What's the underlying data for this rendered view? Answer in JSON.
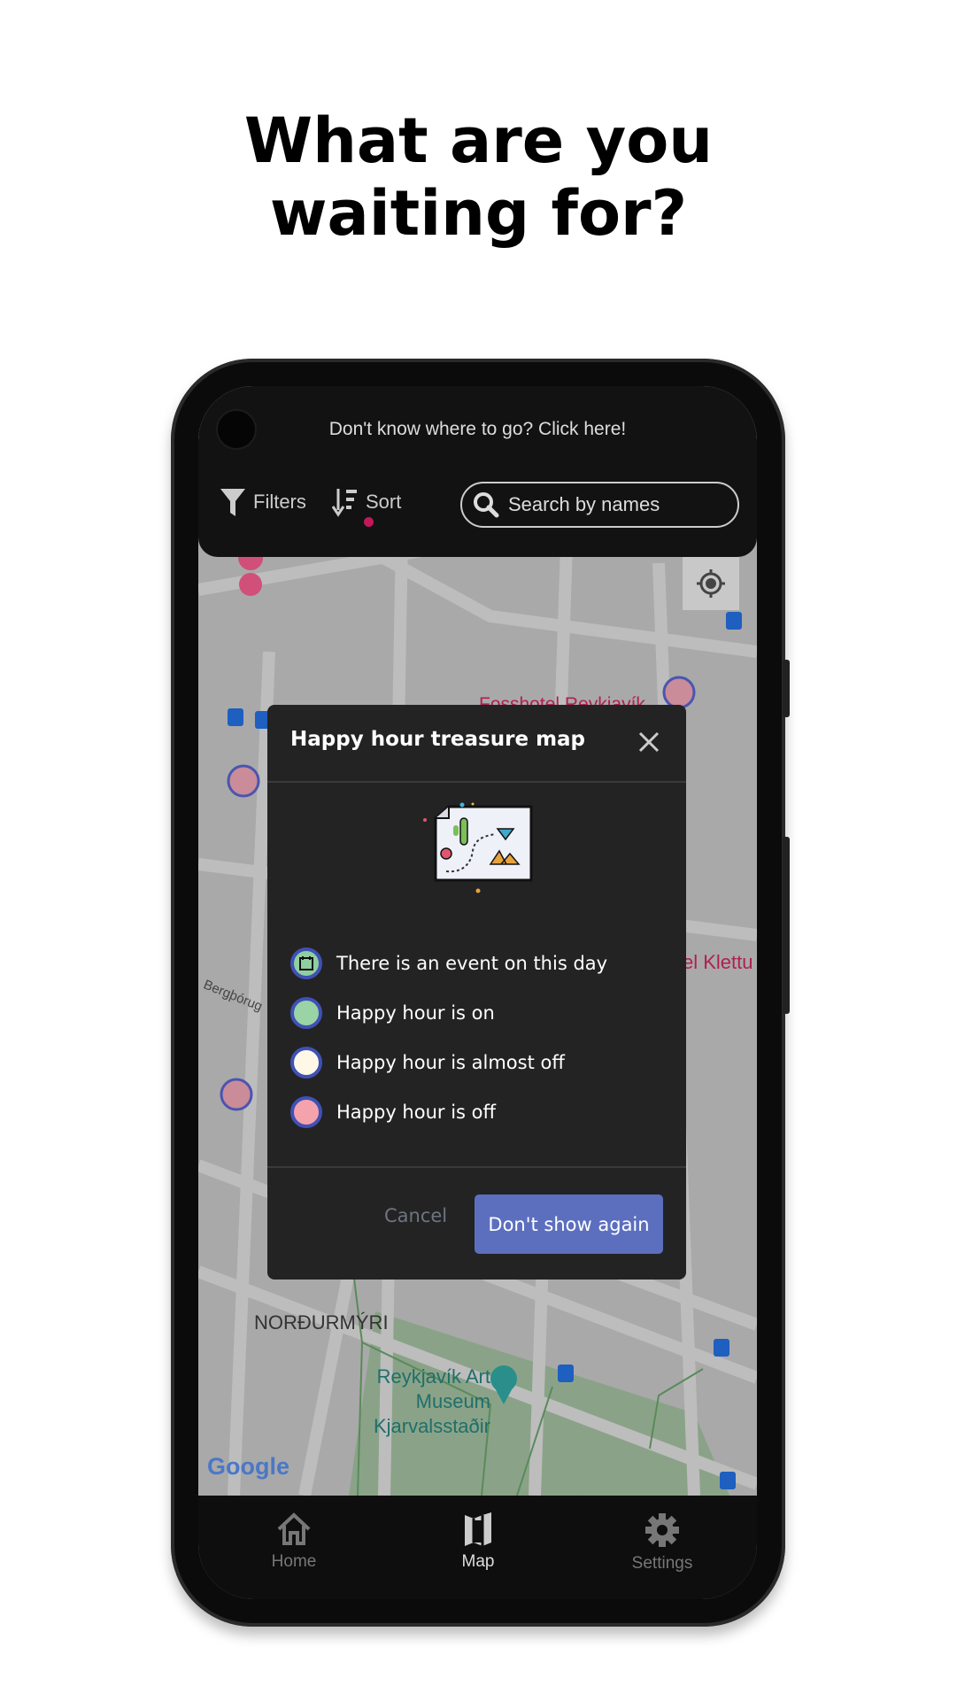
{
  "headline": {
    "line1": "What are you",
    "line2": "waiting for?"
  },
  "top_bar": {
    "hint": "Don't know where to go? Click here!",
    "filters_label": "Filters",
    "sort_label": "Sort",
    "search_placeholder": "Search by names"
  },
  "map": {
    "labels": {
      "district": "NORÐURMÝRI",
      "museum_line1": "Reykjavík Art",
      "museum_line2": "Museum Kjarvalsstaðir",
      "hotel": "Fosshotel Reykjavík",
      "hotel_right": "el Klettu",
      "street": "Bergþórug",
      "attribution": "Google"
    }
  },
  "dialog": {
    "title": "Happy hour treasure map",
    "legend": [
      {
        "label": "There is an event on this day",
        "color": "#8fcfa0",
        "icon": "calendar-icon"
      },
      {
        "label": "Happy hour is on",
        "color": "#9ad3a6"
      },
      {
        "label": "Happy hour is almost off",
        "color": "#fff8e6"
      },
      {
        "label": "Happy hour is off",
        "color": "#f4a3ad"
      }
    ],
    "cancel_label": "Cancel",
    "confirm_label": "Don't show again",
    "accent_color": "#5c6fbf"
  },
  "bottom_nav": {
    "items": [
      {
        "label": "Home",
        "icon": "home-icon",
        "active": false
      },
      {
        "label": "Map",
        "icon": "map-icon",
        "active": true
      },
      {
        "label": "Settings",
        "icon": "gear-icon",
        "active": false
      }
    ]
  }
}
